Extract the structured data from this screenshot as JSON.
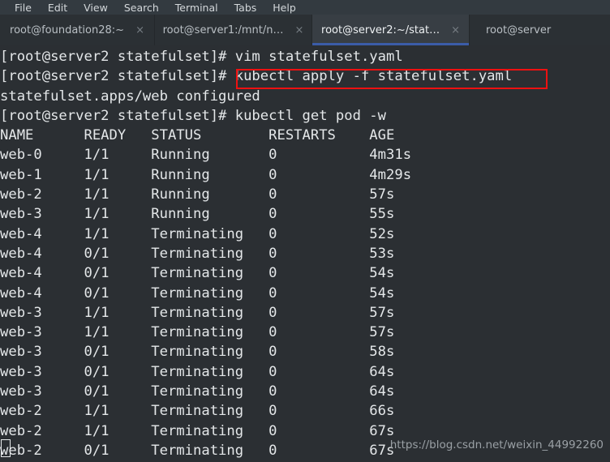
{
  "menubar": {
    "items": [
      {
        "label": "File"
      },
      {
        "label": "Edit"
      },
      {
        "label": "View"
      },
      {
        "label": "Search"
      },
      {
        "label": "Terminal"
      },
      {
        "label": "Tabs"
      },
      {
        "label": "Help"
      }
    ]
  },
  "tabs": {
    "close_glyph": "×",
    "active_index": 2,
    "items": [
      {
        "label": "root@foundation28:~",
        "active": false
      },
      {
        "label": "root@server1:/mnt/n…",
        "active": false
      },
      {
        "label": "root@server2:~/stat…",
        "active": true
      },
      {
        "label": "root@server",
        "active": false
      }
    ]
  },
  "terminal": {
    "prompt": "[root@server2 statefulset]#",
    "lines": [
      "[root@server2 statefulset]# vim statefulset.yaml",
      "[root@server2 statefulset]# kubectl apply -f statefulset.yaml",
      "statefulset.apps/web configured",
      "[root@server2 statefulset]# kubectl get pod -w",
      "NAME      READY   STATUS        RESTARTS    AGE",
      "web-0     1/1     Running       0           4m31s",
      "web-1     1/1     Running       0           4m29s",
      "web-2     1/1     Running       0           57s",
      "web-3     1/1     Running       0           55s",
      "web-4     1/1     Terminating   0           52s",
      "web-4     0/1     Terminating   0           53s",
      "web-4     0/1     Terminating   0           54s",
      "web-4     0/1     Terminating   0           54s",
      "web-3     1/1     Terminating   0           57s",
      "web-3     1/1     Terminating   0           57s",
      "web-3     0/1     Terminating   0           58s",
      "web-3     0/1     Terminating   0           64s",
      "web-3     0/1     Terminating   0           64s",
      "web-2     1/1     Terminating   0           66s",
      "web-2     1/1     Terminating   0           67s",
      "web-2     0/1     Terminating   0           67s"
    ],
    "commands": [
      "vim statefulset.yaml",
      "kubectl apply -f statefulset.yaml",
      "kubectl get pod -w"
    ],
    "output_message": "statefulset.apps/web configured",
    "table": {
      "headers": [
        "NAME",
        "READY",
        "STATUS",
        "RESTARTS",
        "AGE"
      ],
      "rows": [
        [
          "web-0",
          "1/1",
          "Running",
          "0",
          "4m31s"
        ],
        [
          "web-1",
          "1/1",
          "Running",
          "0",
          "4m29s"
        ],
        [
          "web-2",
          "1/1",
          "Running",
          "0",
          "57s"
        ],
        [
          "web-3",
          "1/1",
          "Running",
          "0",
          "55s"
        ],
        [
          "web-4",
          "1/1",
          "Terminating",
          "0",
          "52s"
        ],
        [
          "web-4",
          "0/1",
          "Terminating",
          "0",
          "53s"
        ],
        [
          "web-4",
          "0/1",
          "Terminating",
          "0",
          "54s"
        ],
        [
          "web-4",
          "0/1",
          "Terminating",
          "0",
          "54s"
        ],
        [
          "web-3",
          "1/1",
          "Terminating",
          "0",
          "57s"
        ],
        [
          "web-3",
          "1/1",
          "Terminating",
          "0",
          "57s"
        ],
        [
          "web-3",
          "0/1",
          "Terminating",
          "0",
          "58s"
        ],
        [
          "web-3",
          "0/1",
          "Terminating",
          "0",
          "64s"
        ],
        [
          "web-3",
          "0/1",
          "Terminating",
          "0",
          "64s"
        ],
        [
          "web-2",
          "1/1",
          "Terminating",
          "0",
          "66s"
        ],
        [
          "web-2",
          "1/1",
          "Terminating",
          "0",
          "67s"
        ],
        [
          "web-2",
          "0/1",
          "Terminating",
          "0",
          "67s"
        ]
      ]
    }
  },
  "annotation": {
    "highlight_color": "#ee1111",
    "highlighted_text": "# kubectl apply -f statefulset.yaml"
  },
  "watermark": {
    "text": "https://blog.csdn.net/weixin_44992260"
  },
  "colors": {
    "terminal_bg": "#2b2f33",
    "terminal_fg": "#e4e7e9",
    "tabbar_bg": "#2b3034",
    "active_tab_bg": "#383e44",
    "active_tab_underline": "#3b5ca8",
    "menubar_bg": "#333a40"
  }
}
